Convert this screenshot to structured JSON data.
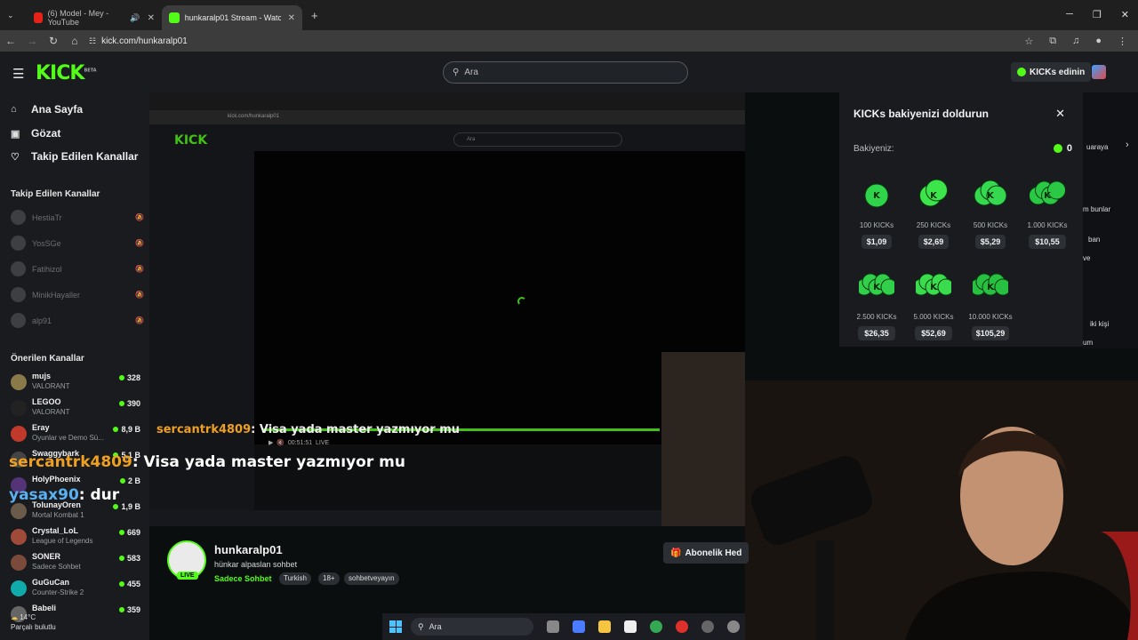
{
  "browser": {
    "tabs": [
      {
        "label": "(6) Model - Mey - YouTube",
        "active": false
      },
      {
        "label": "hunkaralp01 Stream - Watch Li...",
        "active": true
      }
    ],
    "url": "kick.com/hunkaralp01"
  },
  "header": {
    "logo": "KICK",
    "logo_badge": "BETA",
    "search_placeholder": "Ara",
    "get_kicks": "KICKs edinin"
  },
  "sidebar": {
    "nav": [
      {
        "label": "Ana Sayfa",
        "icon": "home-icon"
      },
      {
        "label": "Gözat",
        "icon": "browse-icon"
      },
      {
        "label": "Takip Edilen Kanallar",
        "icon": "heart-icon"
      }
    ],
    "followed_header": "Takip Edilen Kanallar",
    "followed": [
      "HestiaTr",
      "YosSGe",
      "Fatihizol",
      "MinikHayaller",
      "alp91"
    ],
    "recommended_header": "Önerilen Kanallar",
    "recommended": [
      {
        "name": "mujs",
        "category": "VALORANT",
        "viewers": "328",
        "color": "#8a7a4a"
      },
      {
        "name": "LEGOO",
        "category": "VALORANT",
        "viewers": "390",
        "color": "#222222"
      },
      {
        "name": "Eray",
        "category": "Oyunlar ve Demo Sü...",
        "viewers": "8,9 B",
        "color": "#c0392b"
      },
      {
        "name": "Swaggybark",
        "category": "",
        "viewers": "5,1 B",
        "color": "#444444"
      },
      {
        "name": "HolyPhoenix",
        "category": "",
        "viewers": "2 B",
        "color": "#553377"
      },
      {
        "name": "TolunayOren",
        "category": "Mortal Kombat 1",
        "viewers": "1,9 B",
        "color": "#6a5a4a"
      },
      {
        "name": "Crystal_LoL",
        "category": "League of Legends",
        "viewers": "669",
        "color": "#a04a3a"
      },
      {
        "name": "SONER",
        "category": "Sadece Sohbet",
        "viewers": "583",
        "color": "#7a4a3a"
      },
      {
        "name": "GuGuCan",
        "category": "Counter-Strike 2",
        "viewers": "455",
        "color": "#11aaaa"
      },
      {
        "name": "Babeli",
        "category": "",
        "viewers": "359",
        "color": "#666666"
      }
    ],
    "weather_temp": "14°C",
    "weather_desc": "Parçalı bulutlu"
  },
  "overlay_chat": {
    "small_user": "sercantrk4809",
    "small_msg": ": Visa yada master yazmıyor mu",
    "big_user": "sercantrk4809",
    "big_msg": ": Visa yada master yazmıyor mu",
    "user2": "yasax90",
    "msg2": ": dur"
  },
  "inner": {
    "url": "kick.com/hunkaralp01",
    "search": "Ara",
    "time": "00:51:51",
    "live": "LIVE"
  },
  "channel": {
    "name": "hunkaralp01",
    "title": "hünkar alpaslan sohbet",
    "category": "Sadece Sohbet",
    "tags": [
      "Turkish",
      "18+",
      "sohbetveyayın"
    ],
    "live": "LIVE",
    "subscribe_gift": "Abonelik Hed"
  },
  "kicks_panel": {
    "title": "KICKs bakiyenizi doldurun",
    "balance_label": "Bakiyeniz:",
    "balance": "0",
    "packs": [
      {
        "amount": "100 KICKs",
        "price": "$1,09"
      },
      {
        "amount": "250 KICKs",
        "price": "$2,69"
      },
      {
        "amount": "500 KICKs",
        "price": "$5,29"
      },
      {
        "amount": "1.000 KICKs",
        "price": "$10,55"
      },
      {
        "amount": "2.500 KICKs",
        "price": "$26,35"
      },
      {
        "amount": "5.000 KICKs",
        "price": "$52,69"
      },
      {
        "amount": "10.000 KICKs",
        "price": "$105,29"
      }
    ]
  },
  "right_chat": {
    "lines": [
      "uaraya",
      "m bunlar",
      "ban",
      "ve",
      "iki kişi",
      "um"
    ]
  },
  "taskbar": {
    "search": "Ara"
  }
}
